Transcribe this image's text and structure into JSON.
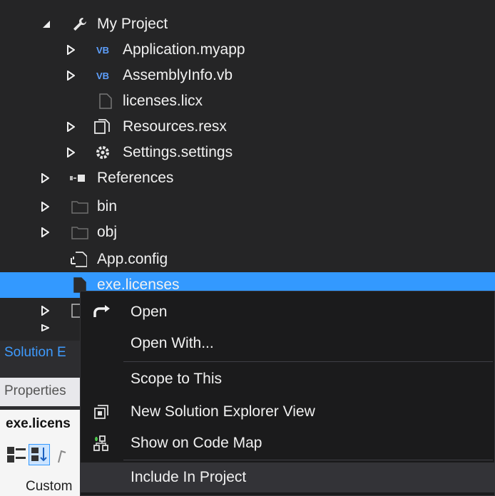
{
  "tree": {
    "items": [
      {
        "label": "My Project"
      },
      {
        "label": "Application.myapp"
      },
      {
        "label": "AssemblyInfo.vb"
      },
      {
        "label": "licenses.licx"
      },
      {
        "label": "Resources.resx"
      },
      {
        "label": "Settings.settings"
      },
      {
        "label": "References"
      },
      {
        "label": "bin"
      },
      {
        "label": "obj"
      },
      {
        "label": "App.config"
      },
      {
        "label": "exe.licenses"
      }
    ],
    "vb_badge": "VB"
  },
  "panel": {
    "solution_tab": "Solution E",
    "properties_title": "Properties",
    "object_name": "exe.licens",
    "toolbar_label": "Custom"
  },
  "context_menu": {
    "items": [
      {
        "label": "Open"
      },
      {
        "label": "Open With..."
      },
      {
        "label": "Scope to This"
      },
      {
        "label": "New Solution Explorer View"
      },
      {
        "label": "Show on Code Map"
      },
      {
        "label": "Include In Project"
      }
    ]
  },
  "colors": {
    "background": "#252526",
    "selection": "#3399ff",
    "menu_background": "#1b1b1c",
    "accent_text": "#3e9bff"
  }
}
